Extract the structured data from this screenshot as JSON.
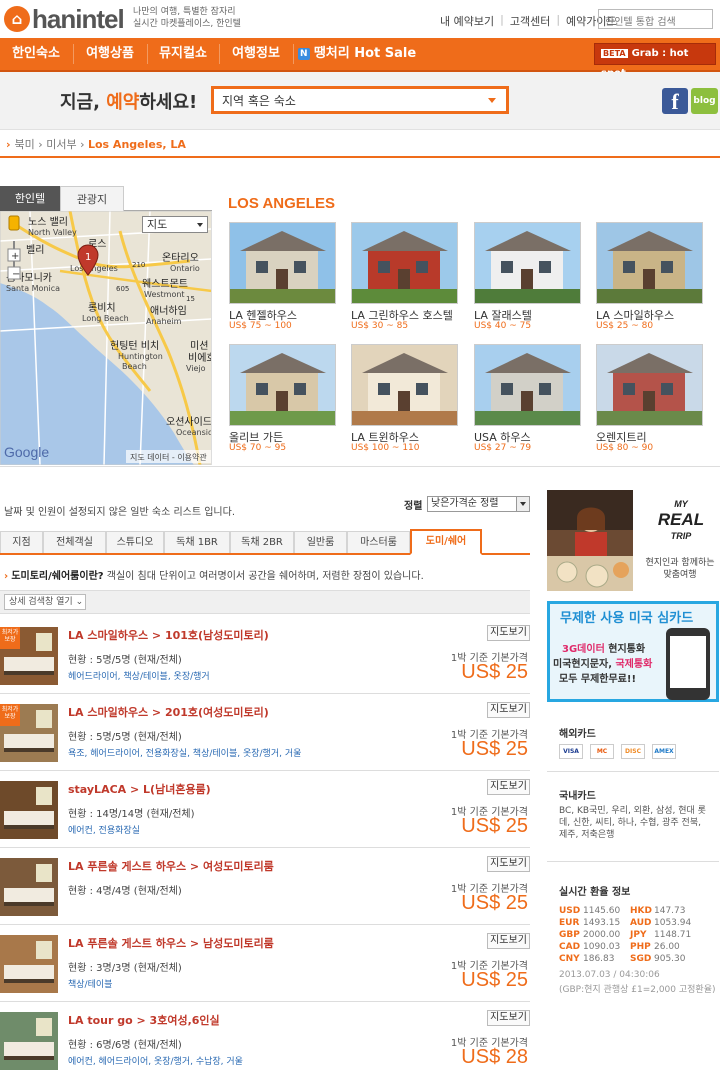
{
  "header": {
    "logo_text": "hanintel",
    "tagline": [
      "나만의 여행, 특별한 잠자리",
      "실시간 마켓플레이스, 한인텔"
    ],
    "links": [
      "내 예약보기",
      "고객센터",
      "예약가이드"
    ],
    "search_placeholder": "한인텔 통합 검색"
  },
  "nav": {
    "items": [
      "한인숙소",
      "여행상품",
      "뮤지컬쇼",
      "여행정보",
      "땡처리 Hot Sale"
    ],
    "n_badge": "N",
    "grab_beta": "BETA",
    "grab_label": "Grab : hot spot"
  },
  "booking": {
    "title_pre": "지금, ",
    "title_hl": "예약",
    "title_post": "하세요!",
    "dest_value": "지역 혹은 숙소",
    "facebook": "f",
    "blog": "blog"
  },
  "breadcrumb": [
    "북미",
    "미서부",
    "Los Angeles, LA"
  ],
  "map": {
    "tabs": [
      "한인텔",
      "관광지"
    ],
    "map_type": "지도",
    "pin_label": "1",
    "labels": [
      {
        "t": "노스 밸리",
        "c": "#222"
      },
      {
        "t": "North Valley",
        "c": "#444"
      },
      {
        "t": "로스",
        "c": "#222"
      },
      {
        "t": "벨리",
        "c": "#222"
      },
      {
        "t": "산타모니카",
        "c": "#222"
      },
      {
        "t": "Santa Monica",
        "c": "#444"
      },
      {
        "t": "Los Angeles",
        "c": "#444"
      },
      {
        "t": "온타리오",
        "c": "#222"
      },
      {
        "t": "Ontario",
        "c": "#444"
      },
      {
        "t": "웨스트몬트",
        "c": "#222"
      },
      {
        "t": "Westmont",
        "c": "#444"
      },
      {
        "t": "롱비치",
        "c": "#222"
      },
      {
        "t": "Long Beach",
        "c": "#444"
      },
      {
        "t": "애너하임",
        "c": "#222"
      },
      {
        "t": "Anaheim",
        "c": "#444"
      },
      {
        "t": "헌팅턴 비치",
        "c": "#222"
      },
      {
        "t": "Huntington",
        "c": "#444"
      },
      {
        "t": "Beach",
        "c": "#444"
      },
      {
        "t": "미션",
        "c": "#222"
      },
      {
        "t": "비에호",
        "c": "#222"
      },
      {
        "t": "Viejo",
        "c": "#444"
      },
      {
        "t": "오션사이드",
        "c": "#222"
      },
      {
        "t": "Oceanside",
        "c": "#444"
      },
      {
        "t": "210",
        "c": "#333"
      },
      {
        "t": "605",
        "c": "#333"
      },
      {
        "t": "15",
        "c": "#333"
      }
    ],
    "google": "Google",
    "attribution": "지도 데이터 - 이용약관"
  },
  "la": {
    "title": "LOS ANGELES",
    "hotels": [
      {
        "name": "LA 헨젤하우스",
        "price": "US$ 75 ~ 100"
      },
      {
        "name": "LA 그린하우스 호스텔",
        "price": "US$ 30 ~ 85"
      },
      {
        "name": "LA 잘래스텔",
        "price": "US$ 40 ~ 75"
      },
      {
        "name": "LA 스마일하우스",
        "price": "US$ 25 ~ 80"
      },
      {
        "name": "올리브 가든",
        "price": "US$ 70 ~ 95"
      },
      {
        "name": "LA 트윈하우스",
        "price": "US$ 100 ~ 110"
      },
      {
        "name": "USA 하우스",
        "price": "US$ 27 ~ 79"
      },
      {
        "name": "오렌지트리",
        "price": "US$ 80 ~ 90"
      }
    ]
  },
  "list": {
    "note": "날짜 및 인원이 설정되지 않은 일반 숙소 리스트 입니다.",
    "sort_label": "정렬",
    "sort_value": "낮은가격순 정렬",
    "tabs": [
      "지점",
      "전체객실",
      "스튜디오",
      "독채 1BR",
      "독채 2BR",
      "일반룸",
      "마스터룸",
      "도미/쉐어"
    ],
    "dorm_q": "도미토리/쉐어룸이란?",
    "dorm_a": " 객실이 침대 단위이고 여러명이서 공간을 쉐어하며, 저렴한 장점이 있습니다.",
    "filter": "상세 검색창 열기",
    "badge": "최저가 보장",
    "map_btn": "지도보기",
    "base_price": "1박 기준 기본가격",
    "rows": [
      {
        "title": "LA 스마일하우스 > 101호(남성도미토리)",
        "cap": "현황 : 5명/5명 (현재/전체)",
        "amen": "헤어드라이어, 책상/테이블, 옷장/행거",
        "price": "US$ 25",
        "badge": true
      },
      {
        "title": "LA 스마일하우스 > 201호(여성도미토리)",
        "cap": "현황 : 5명/5명 (현재/전체)",
        "amen": "욕조, 헤어드라이어, 전용화장실, 책상/테이블, 옷장/행거, 거울",
        "price": "US$ 25",
        "badge": true
      },
      {
        "title": "stayLACA > L(남녀혼용룸)",
        "cap": "현황 : 14명/14명 (현재/전체)",
        "amen": "에어컨, 전용화장실",
        "price": "US$ 25",
        "badge": false
      },
      {
        "title": "LA 푸른솔 게스트 하우스 > 여성도미토리룸",
        "cap": "현황 : 4명/4명 (현재/전체)",
        "amen": "",
        "price": "US$ 25",
        "badge": false
      },
      {
        "title": "LA 푸른솔 게스트 하우스 > 남성도미토리룸",
        "cap": "현황 : 3명/3명 (현재/전체)",
        "amen": "책상/테이블",
        "price": "US$ 25",
        "badge": false
      },
      {
        "title": "LA tour go > 3호여성,6인실",
        "cap": "현황 : 6명/6명 (현재/전체)",
        "amen": "에어컨, 헤어드라이어, 옷장/행거, 수납장, 거울",
        "price": "US$ 28",
        "badge": false
      }
    ]
  },
  "side": {
    "myreal_logo": [
      "MY",
      "REAL",
      "TRIP"
    ],
    "myreal_sub": [
      "현지인과 함께하는",
      "맞춤여행"
    ],
    "sim_title": "무제한 사용 미국 심카드",
    "sim_lines": [
      {
        "a": "3G데이터",
        "b": " 현지통화"
      },
      {
        "a": "미국현지문자, ",
        "b": "국제통화"
      },
      {
        "a": "모두 무제한무료!!",
        "b": ""
      }
    ],
    "overseas_label": "해외카드",
    "cards": [
      {
        "t": "VISA",
        "c": "#1a3a8f"
      },
      {
        "t": "MC",
        "c": "#e8590c"
      },
      {
        "t": "DISC",
        "c": "#f08a24"
      },
      {
        "t": "AMEX",
        "c": "#1f7ac7"
      }
    ],
    "domestic_label": "국내카드",
    "domestic": "BC, KB국민, 우리, 외환, 삼성, 현대 롯데, 신한, 씨티, 하나, 수협, 광주 전북, 제주, 저축은행",
    "fx_label": "실시간 환율 정보",
    "fx": [
      {
        "c": "USD",
        "v": "1145.60"
      },
      {
        "c": "HKD",
        "v": "147.73"
      },
      {
        "c": "EUR",
        "v": "1493.15"
      },
      {
        "c": "AUD",
        "v": "1053.94"
      },
      {
        "c": "GBP",
        "v": "2000.00"
      },
      {
        "c": "JPY",
        "v": "1148.71"
      },
      {
        "c": "CAD",
        "v": "1090.03"
      },
      {
        "c": "PHP",
        "v": "26.00"
      },
      {
        "c": "CNY",
        "v": "186.83"
      },
      {
        "c": "SGD",
        "v": "905.30"
      }
    ],
    "fx_time": "2013.07.03 / 04:30:06",
    "fx_note": "(GBP:현지 관행상 £1=2,000 고정환율)"
  }
}
